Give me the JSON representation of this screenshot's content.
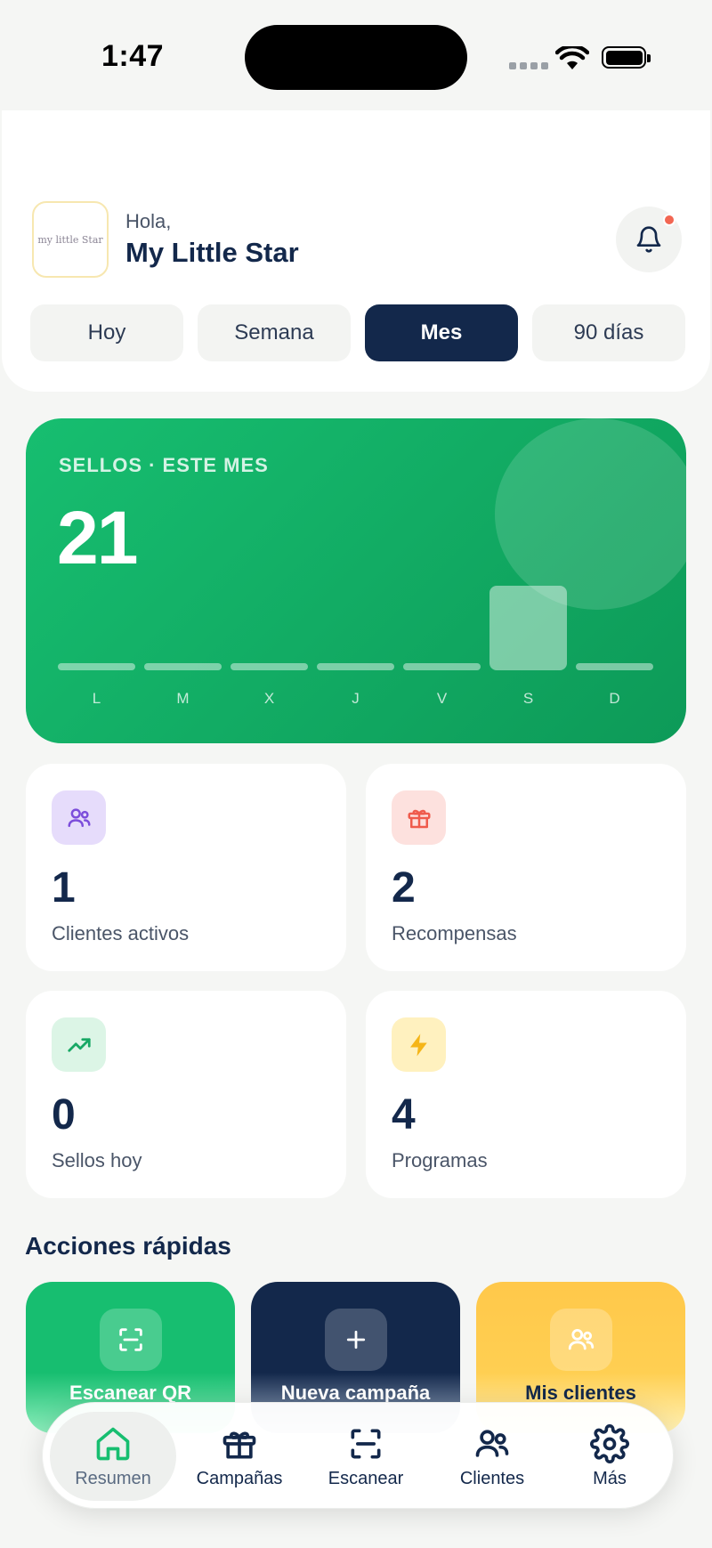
{
  "status_bar": {
    "time": "1:47"
  },
  "header": {
    "greeting": "Hola,",
    "business_name": "My Little Star",
    "logo_text": "my little Star",
    "periods": [
      {
        "label": "Hoy",
        "active": false
      },
      {
        "label": "Semana",
        "active": false
      },
      {
        "label": "Mes",
        "active": true
      },
      {
        "label": "90 días",
        "active": false
      }
    ]
  },
  "stamps_card": {
    "label": "SELLOS · ESTE MES",
    "value": "21"
  },
  "chart_data": {
    "type": "bar",
    "categories": [
      "L",
      "M",
      "X",
      "J",
      "V",
      "S",
      "D"
    ],
    "values": [
      0,
      0,
      0,
      0,
      0,
      21,
      0
    ],
    "ylim": [
      0,
      21
    ]
  },
  "stats": [
    {
      "value": "1",
      "label": "Clientes activos",
      "icon": "users-icon",
      "color": "#e6dcfb"
    },
    {
      "value": "2",
      "label": "Recompensas",
      "icon": "gift-icon",
      "color": "#fde1de"
    },
    {
      "value": "0",
      "label": "Sellos hoy",
      "icon": "trending-up-icon",
      "color": "#dcf5e6"
    },
    {
      "value": "4",
      "label": "Programas",
      "icon": "lightning-icon",
      "color": "#fff1bf"
    }
  ],
  "quick_actions": {
    "title": "Acciones rápidas",
    "items": [
      {
        "label": "Escanear QR",
        "icon": "scan-icon"
      },
      {
        "label": "Nueva campaña",
        "icon": "plus-icon"
      },
      {
        "label": "Mis clientes",
        "icon": "users-icon"
      }
    ]
  },
  "tab_bar": {
    "items": [
      {
        "label": "Resumen",
        "icon": "home-icon",
        "active": true
      },
      {
        "label": "Campañas",
        "icon": "gift-icon",
        "active": false
      },
      {
        "label": "Escanear",
        "icon": "scan-icon",
        "active": false
      },
      {
        "label": "Clientes",
        "icon": "users-icon",
        "active": false
      },
      {
        "label": "Más",
        "icon": "gear-icon",
        "active": false
      }
    ]
  },
  "colors": {
    "primary_navy": "#13284b",
    "green": "#17be70",
    "yellow": "#ffc84a",
    "alert_dot": "#f26652"
  }
}
